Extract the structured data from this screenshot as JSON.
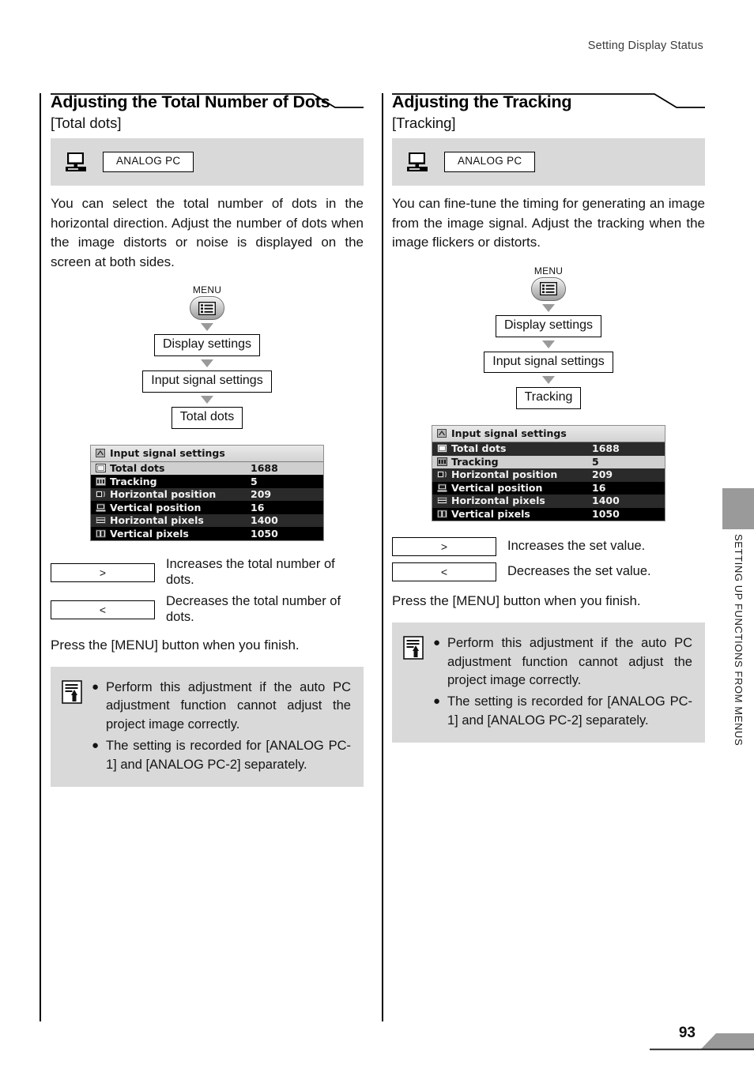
{
  "page": {
    "running_header": "Setting Display Status",
    "page_number": "93",
    "side_tab_text": "SETTING UP FUNCTIONS FROM MENUS"
  },
  "sections": [
    {
      "title": "Adjusting the Total Number of Dots",
      "subtitle": "[Total dots]",
      "signal": {
        "icon": "monitor-icon",
        "chip_label": "ANALOG PC"
      },
      "body": "You can select the total number of dots in the horizontal direction. Adjust the number of dots when the image distorts or noise is displayed on the screen at both sides.",
      "flow": {
        "menu_label": "MENU",
        "menu_icon": "menu-list-icon",
        "steps": [
          "Display settings",
          "Input signal settings",
          "Total dots"
        ]
      },
      "osd": {
        "title": "Input signal settings",
        "title_icon": "osd-signal-icon",
        "rows": [
          {
            "label": "Total dots",
            "value": "1688",
            "style": "sel",
            "icon": "osd-total-dots-icon"
          },
          {
            "label": "Tracking",
            "value": "5",
            "style": "dark",
            "icon": "osd-tracking-icon"
          },
          {
            "label": "Horizontal position",
            "value": "209",
            "style": "dark2",
            "icon": "osd-hpos-icon"
          },
          {
            "label": "Vertical position",
            "value": "16",
            "style": "dark",
            "icon": "osd-vpos-icon"
          },
          {
            "label": "Horizontal pixels",
            "value": "1400",
            "style": "dark2",
            "icon": "osd-hpix-icon"
          },
          {
            "label": "Vertical pixels",
            "value": "1050",
            "style": "dark",
            "icon": "osd-vpix-icon"
          }
        ]
      },
      "legend": [
        {
          "key": ">",
          "desc": "Increases the total number of dots."
        },
        {
          "key": "<",
          "desc": "Decreases the total number of dots."
        }
      ],
      "press_note": "Press the [MENU] button when you finish.",
      "note": {
        "icon": "memo-pencil-icon",
        "bullet": "●",
        "items": [
          "Perform this adjustment if the auto PC adjustment function cannot adjust the project image correctly.",
          "The setting is recorded for [ANALOG PC-1] and [ANALOG PC-2] separately."
        ]
      }
    },
    {
      "title": "Adjusting the Tracking",
      "subtitle": "[Tracking]",
      "signal": {
        "icon": "monitor-icon",
        "chip_label": "ANALOG PC"
      },
      "body": "You can fine-tune the timing for generating an image from the image signal. Adjust the tracking when the image flickers or distorts.",
      "flow": {
        "menu_label": "MENU",
        "menu_icon": "menu-list-icon",
        "steps": [
          "Display settings",
          "Input signal settings",
          "Tracking"
        ]
      },
      "osd": {
        "title": "Input signal settings",
        "title_icon": "osd-signal-icon",
        "rows": [
          {
            "label": "Total dots",
            "value": "1688",
            "style": "dark2",
            "icon": "osd-total-dots-icon"
          },
          {
            "label": "Tracking",
            "value": "5",
            "style": "sel",
            "icon": "osd-tracking-icon"
          },
          {
            "label": "Horizontal position",
            "value": "209",
            "style": "dark2",
            "icon": "osd-hpos-icon"
          },
          {
            "label": "Vertical position",
            "value": "16",
            "style": "dark",
            "icon": "osd-vpos-icon"
          },
          {
            "label": "Horizontal pixels",
            "value": "1400",
            "style": "dark2",
            "icon": "osd-hpix-icon"
          },
          {
            "label": "Vertical pixels",
            "value": "1050",
            "style": "dark",
            "icon": "osd-vpix-icon"
          }
        ]
      },
      "legend": [
        {
          "key": ">",
          "desc": "Increases the set value."
        },
        {
          "key": "<",
          "desc": "Decreases the set value."
        }
      ],
      "press_note": "Press the [MENU] button when you finish.",
      "note": {
        "icon": "memo-pencil-icon",
        "bullet": "●",
        "items": [
          "Perform this adjustment if the auto PC adjustment function cannot adjust the project image correctly.",
          "The setting is recorded for [ANALOG PC-1] and [ANALOG PC-2] separately."
        ]
      }
    }
  ],
  "colors": {
    "band_gray": "#d9d9d9",
    "side_tab_gray": "#9a9a9a",
    "osd_selected": "#cfcfcf",
    "rule_black": "#000000"
  }
}
